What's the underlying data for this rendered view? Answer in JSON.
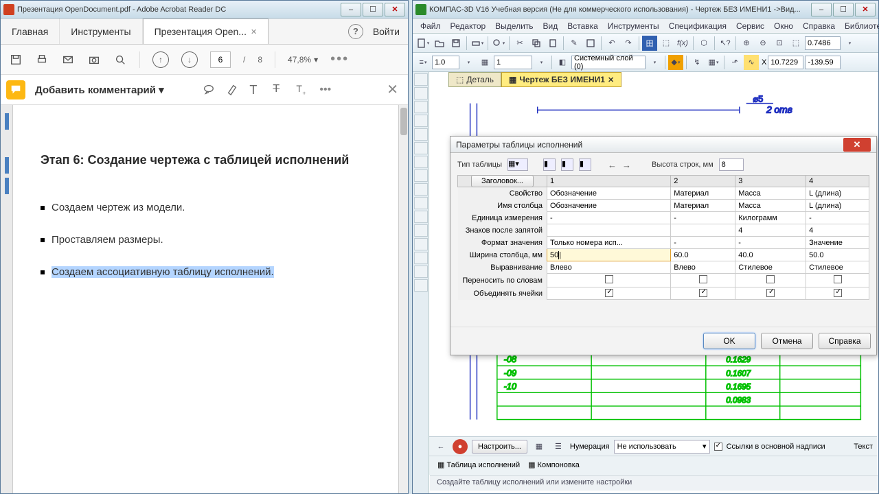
{
  "acrobat": {
    "title": "Презентация OpenDocument.pdf - Adobe Acrobat Reader DC",
    "tabs": {
      "home": "Главная",
      "tools": "Инструменты",
      "doc": "Презентация Open..."
    },
    "signin": "Войти",
    "page_current": "6",
    "page_sep": "/",
    "page_total": "8",
    "zoom": "47,8%",
    "comment": "Добавить комментарий",
    "doc_heading": "Этап 6: Создание чертежа с таблицей исполнений",
    "bullet1": "Создаем чертеж из модели.",
    "bullet2": "Проставляем размеры.",
    "bullet3": "Создаем ассоциативную таблицу исполнений."
  },
  "kompas": {
    "title": "КОМПАС-3D V16 Учебная версия (Не для коммерческого использования) - Чертеж БЕЗ ИМЕНИ1 ->Вид...",
    "menus": [
      "Файл",
      "Редактор",
      "Выделить",
      "Вид",
      "Вставка",
      "Инструменты",
      "Спецификация",
      "Сервис",
      "Окно",
      "Справка",
      "Библиотеки"
    ],
    "fx": "f(x)",
    "scale": "0.7486",
    "lw": "1.0",
    "sheet": "1",
    "layer": "Системный слой (0)",
    "coord_x": "10.7229",
    "coord_y": "-139.59",
    "tab_detail": "Деталь",
    "tab_drawing": "Чертеж БЕЗ ИМЕНИ1",
    "anno_holes": "2 отв"
  },
  "dialog": {
    "title": "Параметры таблицы исполнений",
    "type_label": "Тип таблицы",
    "row_h_label": "Высота строк, мм",
    "row_h": "8",
    "header_btn": "Заголовок...",
    "cols": [
      "1",
      "2",
      "3",
      "4"
    ],
    "rows": {
      "prop": {
        "label": "Свойство",
        "v": [
          "Обозначение",
          "Материал",
          "Масса",
          "L (длина)"
        ]
      },
      "colname": {
        "label": "Имя столбца",
        "v": [
          "Обозначение",
          "Материал",
          "Масса",
          "L (длина)"
        ]
      },
      "unit": {
        "label": "Единица измерения",
        "v": [
          "-",
          "-",
          "Килограмм",
          "-"
        ]
      },
      "dec": {
        "label": "Знаков после запятой",
        "v": [
          "",
          "",
          "4",
          "4"
        ]
      },
      "fmt": {
        "label": "Формат значения",
        "v": [
          "Только номера исп...",
          "-",
          "-",
          "Значение"
        ]
      },
      "width": {
        "label": "Ширина столбца, мм",
        "v": [
          "50",
          "60.0",
          "40.0",
          "50.0"
        ]
      },
      "align": {
        "label": "Выравнивание",
        "v": [
          "Влево",
          "Влево",
          "Стилевое",
          "Стилевое"
        ]
      },
      "wrap": {
        "label": "Переносить по словам"
      },
      "merge": {
        "label": "Объединять ячейки"
      }
    },
    "ok": "OK",
    "cancel": "Отмена",
    "help": "Справка"
  },
  "bottom": {
    "settings": "Настроить...",
    "numbering": "Нумерация",
    "numbering_val": "Не использовать",
    "links": "Ссылки в основной надписи",
    "text": "Текст",
    "tab1": "Таблица исполнений",
    "tab2": "Компоновка",
    "status": "Создайте таблицу исполнений или измените настройки"
  }
}
